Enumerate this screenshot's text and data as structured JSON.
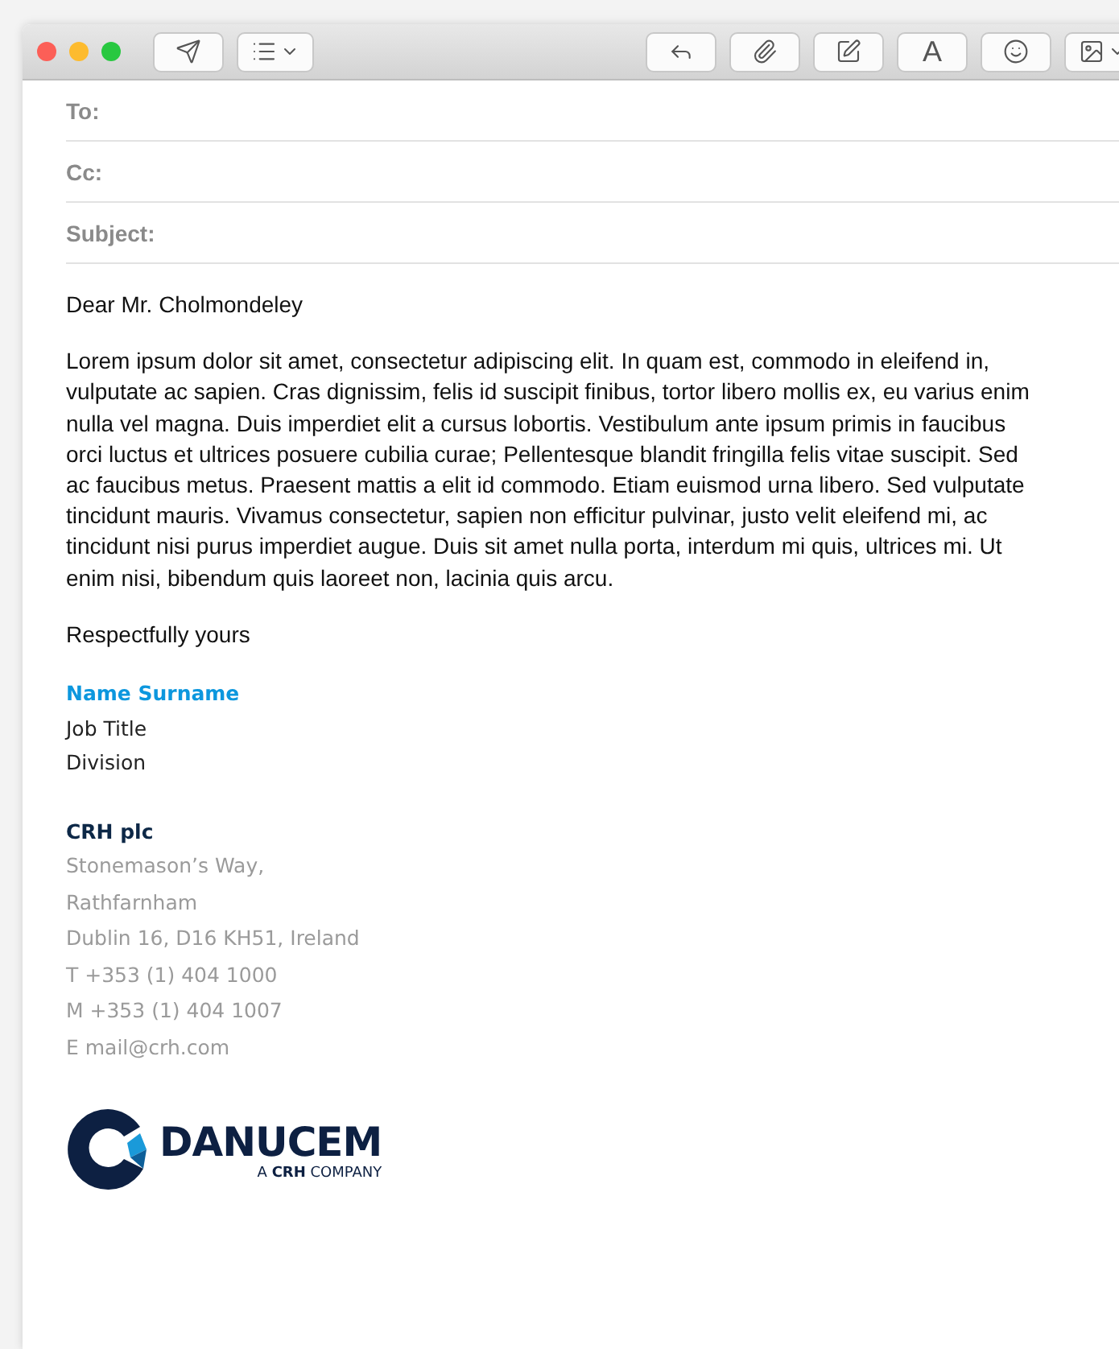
{
  "toolbar": {
    "font_button": "A"
  },
  "header_fields": [
    {
      "label": "To:"
    },
    {
      "label": "Cc:"
    },
    {
      "label": "Subject:"
    }
  ],
  "greeting": "Dear Mr. Cholmondeley",
  "body": "Lorem ipsum dolor sit amet, consectetur adipiscing elit. In quam est, commodo in eleifend in, vulputate ac sapien. Cras dignissim, felis id suscipit finibus, tortor libero mollis ex, eu varius enim nulla vel magna. Duis imperdiet elit a cursus lobortis. Vestibulum ante ipsum primis in faucibus orci luctus et ultrices posuere cubilia curae; Pellentesque blandit fringilla felis vitae suscipit. Sed ac faucibus metus. Praesent mattis a elit id commodo. Etiam euismod urna libero. Sed vulputate tincidunt mauris. Vivamus consectetur, sapien non efficitur pulvinar, justo velit eleifend mi, ac tincidunt nisi purus imperdiet augue. Duis sit amet nulla porta, interdum mi quis, ultrices mi. Ut enim nisi, bibendum quis laoreet non, lacinia quis arcu.",
  "closing": "Respectfully yours",
  "signature": {
    "name": "Name Surname",
    "job_title": "Job Title",
    "division": "Division"
  },
  "company": {
    "name": "CRH plc",
    "lines": [
      "Stonemason’s Way,",
      "Rathfarnham",
      "Dublin 16, D16 KH51, Ireland",
      "T +353 (1) 404 1000",
      "M +353 (1) 404 1007",
      "E mail@crh.com"
    ]
  },
  "logo": {
    "wordmark": "DANUCEM",
    "tagline": "A **CRH** COMPANY"
  }
}
